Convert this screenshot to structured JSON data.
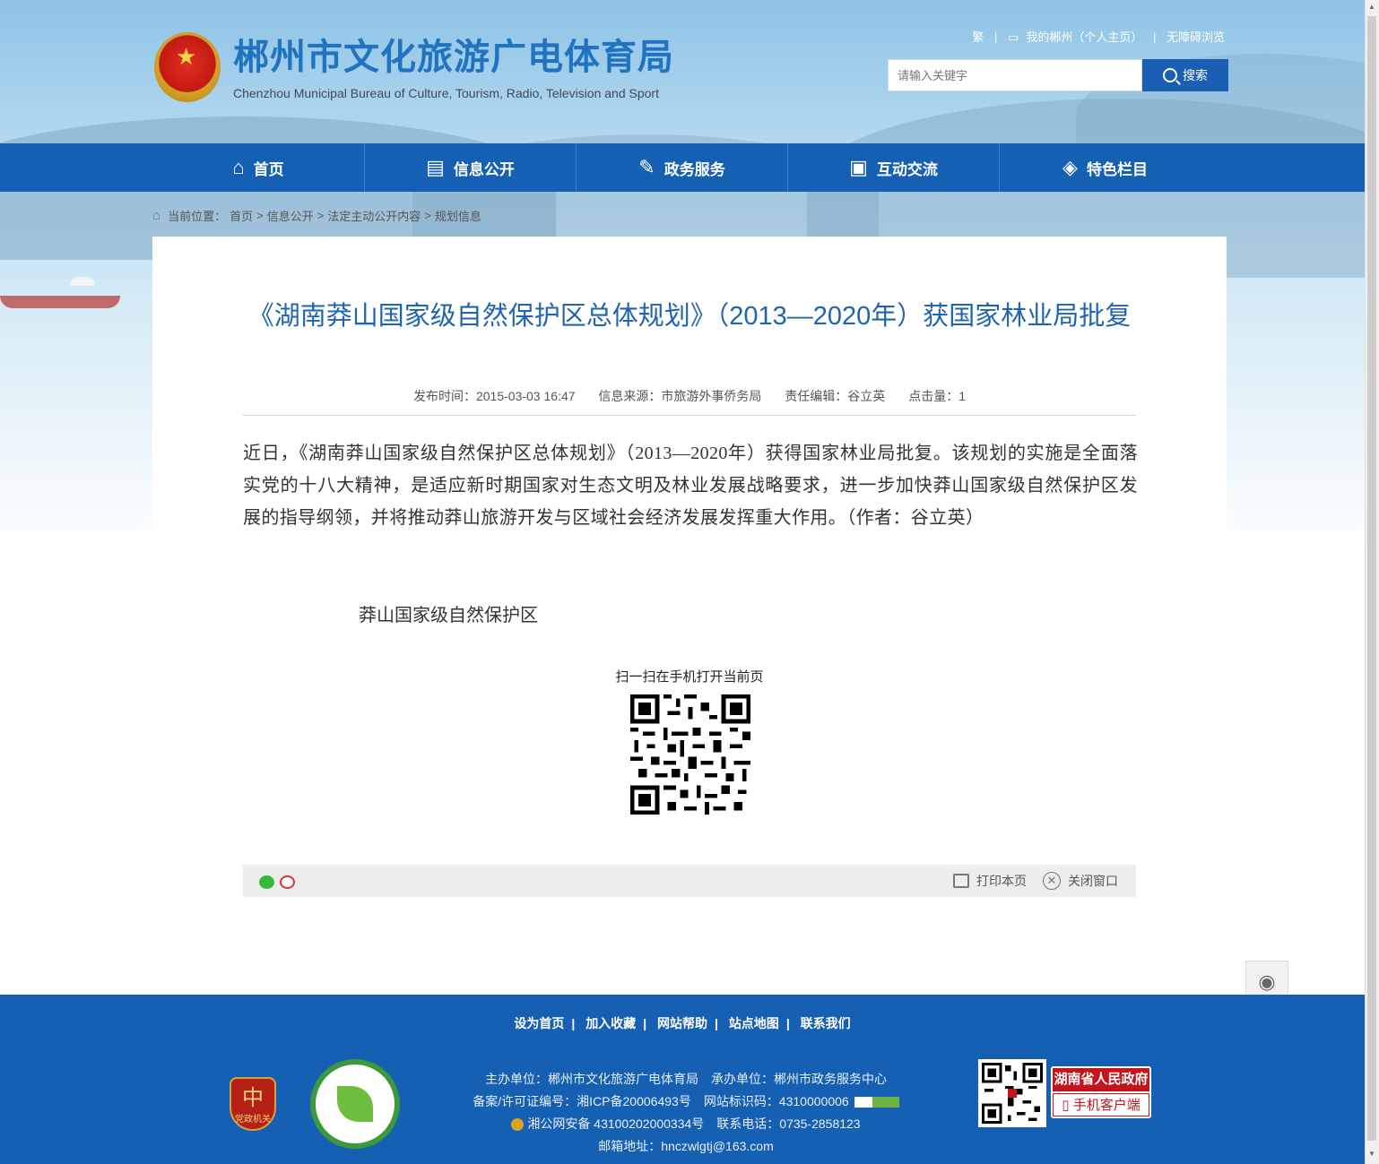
{
  "header": {
    "title": "郴州市文化旅游广电体育局",
    "subtitle": "Chenzhou Municipal Bureau of Culture, Tourism, Radio, Television and Sport",
    "top_links": {
      "traditional": "繁",
      "my_chenzhou": "我的郴州（个人主页）",
      "accessible": "无障碍浏览"
    },
    "search": {
      "placeholder": "请输入关键字",
      "button_label": "搜索"
    }
  },
  "nav": {
    "items": [
      {
        "label": "首页",
        "icon": "home-icon"
      },
      {
        "label": "信息公开",
        "icon": "document-icon"
      },
      {
        "label": "政务服务",
        "icon": "edit-icon"
      },
      {
        "label": "互动交流",
        "icon": "chat-icon"
      },
      {
        "label": "特色栏目",
        "icon": "layers-icon"
      }
    ]
  },
  "breadcrumb": {
    "prefix": "当前位置：",
    "items": [
      "首页",
      "信息公开",
      "法定主动公开内容",
      "规划信息"
    ],
    "separator": ">"
  },
  "article": {
    "title": "《湖南莽山国家级自然保护区总体规划》（2013—2020年）获国家林业局批复",
    "meta": {
      "publish_time": "发布时间：2015-03-03 16:47",
      "source": "信息来源：市旅游外事侨务局",
      "editor": "责任编辑：谷立英",
      "hits": "点击量：1"
    },
    "body": "近日，《湖南莽山国家级自然保护区总体规划》（2013—2020年）获得国家林业局批复。该规划的实施是全面落实党的十八大精神，是适应新时期国家对生态文明及林业发展战略要求，进一步加快莽山国家级自然保护区发展的指导纲领，并将推动莽山旅游开发与区域社会经济发展发挥重大作用。（作者：谷立英）",
    "image_caption": "莽山国家级自然保护区",
    "qr_label": "扫一扫在手机打开当前页"
  },
  "share_bar": {
    "print_label": "打印本页",
    "close_label": "关闭窗口"
  },
  "footer": {
    "links": [
      "设为首页",
      "加入收藏",
      "网站帮助",
      "站点地图",
      "联系我们"
    ],
    "line1": "主办单位：郴州市文化旅游广电体育局　承办单位：郴州市政务服务中心",
    "line2": "备案/许可证编号：湘ICP备20006493号　网站标识码：4310000006",
    "line3": "湘公网安备 43100202000334号　联系电话：0735-2858123",
    "line4": "邮箱地址：hnczwlgtj@163.com",
    "party_badge_text": "党政机关",
    "app_badge_top": "湖南省人民政府",
    "app_badge_bottom": "手机客户端"
  },
  "colors": {
    "brand_blue": "#1660b4",
    "title_blue": "#1f64b2",
    "app_red": "#c3151b"
  }
}
